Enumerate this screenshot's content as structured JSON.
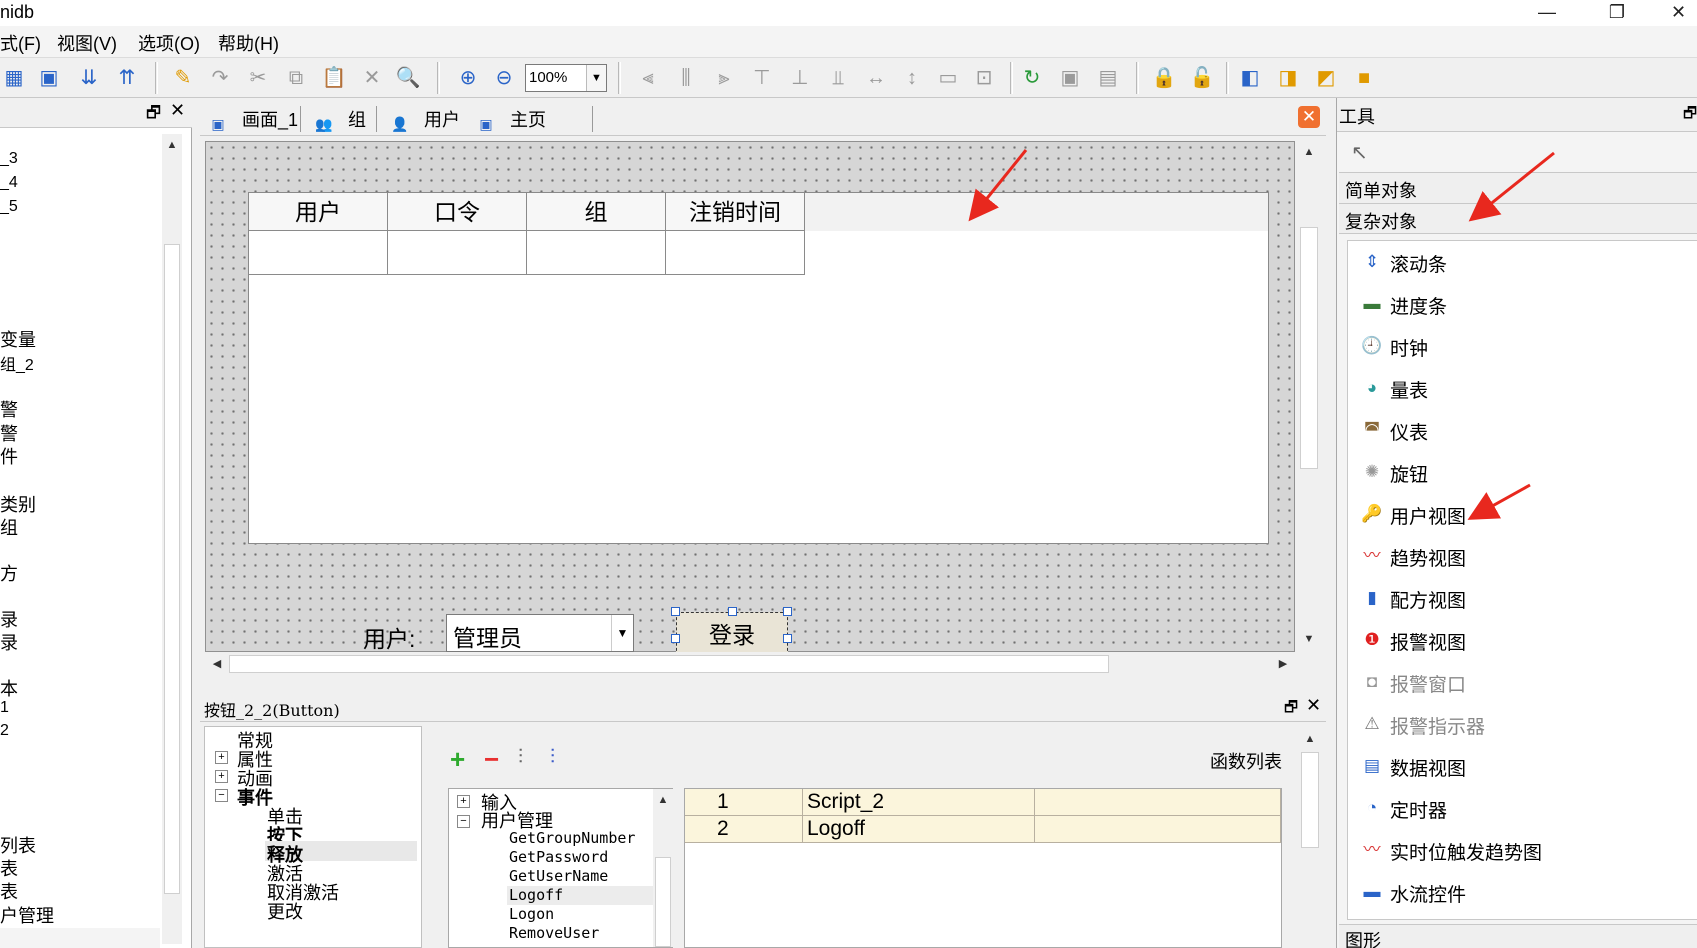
{
  "window": {
    "title": "nidb",
    "minimize": "—",
    "restore": "❐",
    "close": "✕"
  },
  "menu": [
    "式(F)",
    "视图(V)",
    "选项(O)",
    "帮助(H)"
  ],
  "toolbar": {
    "zoom": "100%"
  },
  "left_panel": {
    "items": [
      "_3",
      "_4",
      "_5",
      "变量",
      "组_2",
      "警",
      "警",
      "件",
      "类别",
      "组",
      "方",
      "录",
      "录",
      "本",
      "1",
      "2",
      "列表",
      "表",
      "表",
      "户管理"
    ]
  },
  "tabs": [
    "画面_1",
    "组",
    "用户",
    "主页"
  ],
  "canvas": {
    "userview_columns": [
      "用户",
      "口令",
      "组",
      "注销时间"
    ],
    "user_label": "用户:",
    "user_combo_value": "管理员",
    "login_label": "登录"
  },
  "property_panel": {
    "title": "按钮_2_2(Button)",
    "tree": [
      "常规",
      "属性",
      "动画",
      "事件",
      "单击",
      "按下",
      "释放",
      "激活",
      "取消激活",
      "更改"
    ],
    "func_list_label": "函数列表",
    "func_tree": [
      "输入",
      "用户管理",
      "GetGroupNumber",
      "GetPassword",
      "GetUserName",
      "Logoff",
      "Logon",
      "RemoveUser"
    ],
    "func_table": [
      {
        "num": "1",
        "name": "Script_2"
      },
      {
        "num": "2",
        "name": "Logoff"
      }
    ]
  },
  "tools_panel": {
    "title": "工具",
    "categories": [
      "简单对象",
      "复杂对象"
    ],
    "items": [
      {
        "label": "滚动条",
        "icon": "scrollbar-icon"
      },
      {
        "label": "进度条",
        "icon": "progressbar-icon"
      },
      {
        "label": "时钟",
        "icon": "clock-icon"
      },
      {
        "label": "量表",
        "icon": "gauge-icon"
      },
      {
        "label": "仪表",
        "icon": "meter-icon"
      },
      {
        "label": "旋钮",
        "icon": "knob-icon"
      },
      {
        "label": "用户视图",
        "icon": "user-view-icon"
      },
      {
        "label": "趋势视图",
        "icon": "trend-view-icon"
      },
      {
        "label": "配方视图",
        "icon": "recipe-view-icon"
      },
      {
        "label": "报警视图",
        "icon": "alarm-view-icon"
      },
      {
        "label": "报警窗口",
        "icon": "alarm-window-icon"
      },
      {
        "label": "报警指示器",
        "icon": "alarm-indicator-icon"
      },
      {
        "label": "数据视图",
        "icon": "data-view-icon"
      },
      {
        "label": "定时器",
        "icon": "timer-icon"
      },
      {
        "label": "实时位触发趋势图",
        "icon": "bit-trigger-trend-icon"
      },
      {
        "label": "水流控件",
        "icon": "water-flow-icon"
      }
    ],
    "shapes_category": "图形"
  },
  "annotation_color": "#e8281e"
}
